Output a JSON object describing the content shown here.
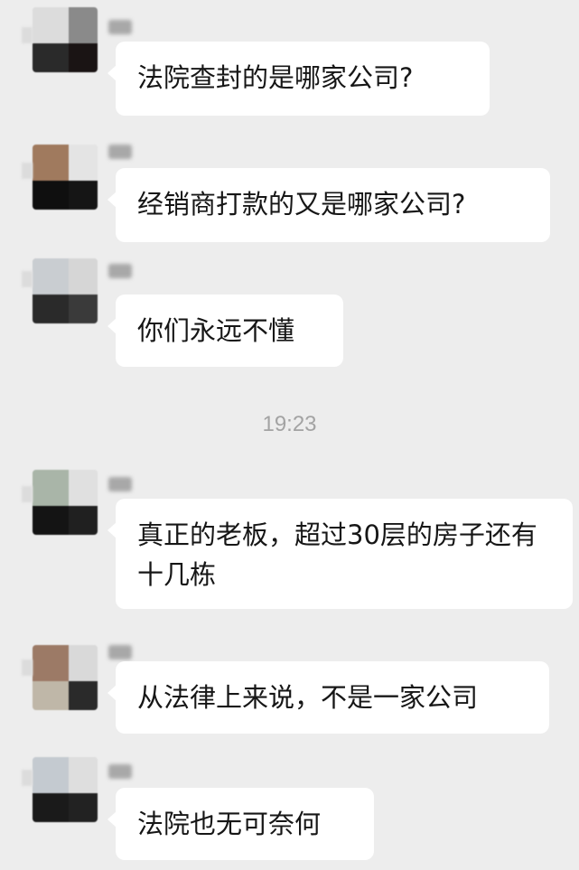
{
  "messages": [
    {
      "text": "法院查封的是哪家公司?",
      "avatar_colors": [
        "#dcdcdc",
        "#8a8a8a",
        "#2a2a2a",
        "#1a1414"
      ]
    },
    {
      "text": "经销商打款的又是哪家公司?",
      "avatar_colors": [
        "#a07a5e",
        "#e4e4e4",
        "#0f0f0f",
        "#151515"
      ]
    },
    {
      "text": "你们永远不懂",
      "avatar_colors": [
        "#c9cdd1",
        "#d6d6d6",
        "#2a2a2a",
        "#3a3a3a"
      ]
    },
    {
      "text": "真正的老板，超过30层的房子还有十几栋",
      "avatar_colors": [
        "#a9b5a8",
        "#e0e0e0",
        "#141414",
        "#202020"
      ]
    },
    {
      "text": "从法律上来说，不是一家公司",
      "avatar_colors": [
        "#9c7a66",
        "#d9d9d9",
        "#bfb7a8",
        "#2a2a2a"
      ]
    },
    {
      "text": "法院也无可奈何",
      "avatar_colors": [
        "#c4cad0",
        "#dedede",
        "#1a1a1a",
        "#222222"
      ]
    }
  ],
  "timestamp": "19:23",
  "colors": {
    "background": "#ededed",
    "bubble": "#ffffff",
    "text": "#161616",
    "timestamp": "#a3a3a3"
  }
}
